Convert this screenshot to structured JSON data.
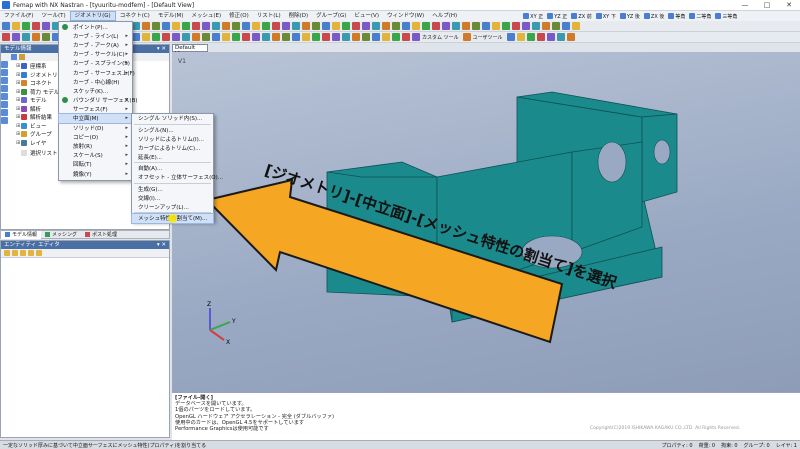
{
  "window": {
    "title": "Femap with NX Nastran - [tyuuritu-modfem] - [Default View]",
    "controls": [
      "—",
      "□",
      "✕"
    ]
  },
  "menubar": {
    "items": [
      "ファイル(F)",
      "ツール(T)",
      "ジオメトリ(G)",
      "コネクト(C)",
      "モデル(M)",
      "メッシュ(E)",
      "修正(O)",
      "リスト(L)",
      "削除(D)",
      "グループ(G)",
      "ビュー(V)",
      "ウィンドウ(W)",
      "ヘルプ(H)"
    ],
    "active_index": 2,
    "view_buttons": [
      "XY 正",
      "YZ 正",
      "ZX 前",
      "XY 下",
      "YZ 後",
      "ZX 後",
      "等角",
      "二等角",
      "三等角"
    ]
  },
  "toolbar2": {
    "custom_tools": "カスタム ツール",
    "user_tools": "ユーザツール"
  },
  "model_panel": {
    "title": "モデル情報",
    "items": [
      {
        "label": "座標系",
        "color": "#3a64c8"
      },
      {
        "label": "ジオメトリ",
        "color": "#2f7fd5"
      },
      {
        "label": "コネクト",
        "color": "#d4842c"
      },
      {
        "label": "荷力 モデル",
        "color": "#3e8f3e"
      },
      {
        "label": "モデル",
        "color": "#6a6acd"
      },
      {
        "label": "解析",
        "color": "#8b4bb0"
      },
      {
        "label": "解析結果",
        "color": "#c63b3b"
      },
      {
        "label": "ビュー",
        "color": "#3a8fd0"
      },
      {
        "label": "グループ",
        "color": "#d4a02c"
      },
      {
        "label": "レイヤ",
        "color": "#4a7a9a"
      }
    ],
    "selection_list": "選択リスト"
  },
  "panel_tabs": [
    "モデル情報",
    "メッシング",
    "ポスト処理"
  ],
  "entity_panel": {
    "title": "エンティティ エディタ"
  },
  "view": {
    "tab_label": "Default View",
    "viewport_label": "V1"
  },
  "geometry_menu": {
    "items": [
      {
        "label": "ポイント(P)...",
        "arrow": false,
        "sep_after": false
      },
      {
        "label": "カーブ - ライン(L)",
        "arrow": true,
        "sep_after": false
      },
      {
        "label": "カーブ - アーク(A)",
        "arrow": true,
        "sep_after": false
      },
      {
        "label": "カーブ - サークル(C)",
        "arrow": true,
        "sep_after": false
      },
      {
        "label": "カーブ - スプライン(S)",
        "arrow": true,
        "sep_after": false
      },
      {
        "label": "カーブ - サーフェス上(F)",
        "arrow": true,
        "sep_after": false
      },
      {
        "label": "カーブ - 中心線(H)",
        "arrow": false,
        "sep_after": false
      },
      {
        "label": "スケッチ(K)...",
        "arrow": false,
        "sep_after": false
      },
      {
        "label": "バウンダリ サーフェス(B)",
        "arrow": true,
        "sep_after": false
      },
      {
        "label": "サーフェス(F)",
        "arrow": true,
        "sep_after": false
      },
      {
        "label": "中立面(M)",
        "arrow": true,
        "sep_after": false
      },
      {
        "label": "ソリッド(D)",
        "arrow": true,
        "sep_after": false
      },
      {
        "label": "コピー(O)",
        "arrow": true,
        "sep_after": false
      },
      {
        "label": "放射(R)",
        "arrow": true,
        "sep_after": false
      },
      {
        "label": "スケール(S)",
        "arrow": true,
        "sep_after": false
      },
      {
        "label": "回転(T)",
        "arrow": true,
        "sep_after": false
      },
      {
        "label": "鏡像(Y)",
        "arrow": true,
        "sep_after": false
      }
    ],
    "highlighted_index": 10
  },
  "midplane_menu": {
    "items": [
      {
        "label": "シングル ソリッド内(S)...",
        "sep_after": true
      },
      {
        "label": "シングル(N)...",
        "sep_after": false
      },
      {
        "label": "ソリッドによるトリム(I)...",
        "sep_after": false
      },
      {
        "label": "カーブによるトリム(C)...",
        "sep_after": false
      },
      {
        "label": "延長(E)...",
        "sep_after": true
      },
      {
        "label": "自動(A)...",
        "sep_after": false
      },
      {
        "label": "オフセット - 立体サーフェス(O)...",
        "sep_after": true
      },
      {
        "label": "生成(G)...",
        "sep_after": false
      },
      {
        "label": "交線(I)...",
        "sep_after": false
      },
      {
        "label": "クリーンアップ(L)...",
        "sep_after": true
      },
      {
        "label": "メッシュ特性の割当て(M)...",
        "sep_after": false
      }
    ],
    "highlighted_index": 10
  },
  "callout": {
    "text": "[ジオメトリ]-[中立面]-[メッシュ特性の割当て]を選択",
    "fill": "#f5a623",
    "stroke": "#1a1a1a"
  },
  "model_color": "#1a8a8c",
  "triad": {
    "x": "X",
    "y": "Y",
    "z": "Z"
  },
  "messages": [
    {
      "text": "[ファイル-開く]",
      "bold": true
    },
    {
      "text": "データベースを開いています。",
      "bold": false
    },
    {
      "text": "1個のパーツをロードしています。",
      "bold": false
    },
    {
      "text": "OpenGL ハードウェア アクセラレーション - 完全 (ダブルバッファ)",
      "bold": false
    },
    {
      "text": "使用中のカードは、OpenGL 4.5をサポートしています",
      "bold": false
    },
    {
      "text": "Performance Graphicsは使用可能です",
      "bold": false
    }
  ],
  "copyright": "Copyright(C)2019 ISHIKAWA KAGAKU CO.,LTD. All Rights Reserved.",
  "status": {
    "text": "一定なソリッド厚みに基づいて中立面サーフェスにメッシュ特性(プロパティ)を割り当てる",
    "counts": [
      "プロパティ: 0",
      "荷重: 0",
      "拘束: 0",
      "グループ: 0",
      "レイヤ: 1"
    ]
  }
}
